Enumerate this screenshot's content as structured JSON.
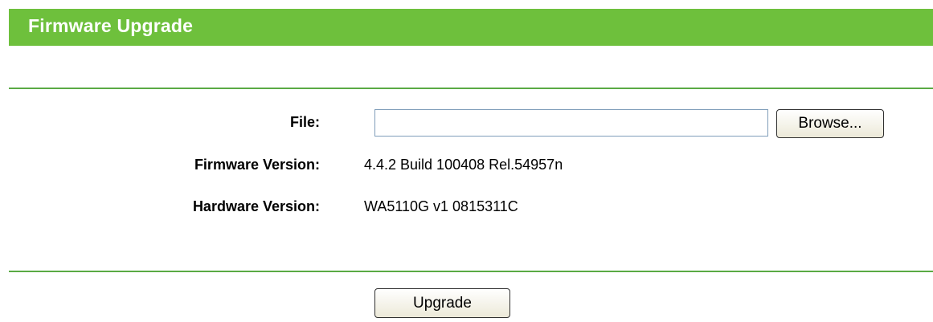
{
  "header": {
    "title": "Firmware Upgrade"
  },
  "form": {
    "file_label": "File:",
    "file_value": "",
    "browse_label": "Browse...",
    "firmware_label": "Firmware Version:",
    "firmware_value": "4.4.2 Build 100408 Rel.54957n",
    "hardware_label": "Hardware Version:",
    "hardware_value": "WA5110G v1 0815311C"
  },
  "actions": {
    "upgrade_label": "Upgrade"
  },
  "colors": {
    "header_bg": "#6ec03c",
    "divider": "#5aaa44",
    "header_text": "#ffffff"
  }
}
